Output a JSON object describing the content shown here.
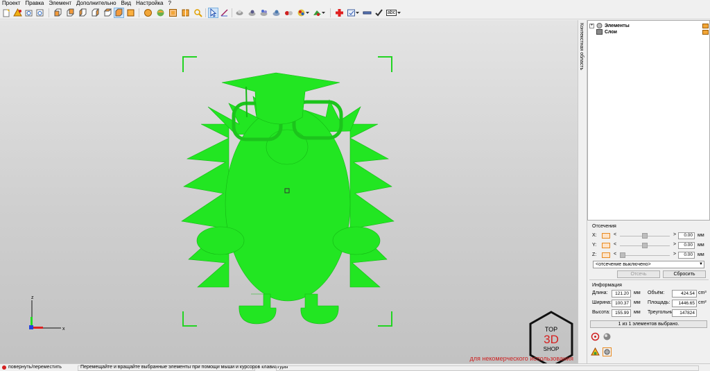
{
  "menu": [
    "Проект",
    "Правка",
    "Элемент",
    "Дополнительно",
    "Вид",
    "Настройка",
    "?"
  ],
  "toolbar_icons": [
    "new-project-icon",
    "add-element-icon",
    "open-icon",
    "save-icon",
    "view-front-icon",
    "view-back-icon",
    "view-left-icon",
    "view-right-icon",
    "view-top-icon",
    "view-perspective-icon",
    "move-icon",
    "rotate-icon",
    "scale-icon",
    "mirror-icon",
    "zoom-icon",
    "select-arrow-icon",
    "measure-icon",
    "sphere-icon",
    "shading-icon",
    "wire-icon",
    "light-icon",
    "color-balls-icon",
    "render-icon",
    "palette-icon",
    "red-cross-icon",
    "settings-icon",
    "minus-icon",
    "checkmark-icon",
    "text-abc-icon"
  ],
  "toolbar_text_abc": "abc",
  "side_tab": "Контекстная область",
  "tree": {
    "items": [
      {
        "label": "Элементы"
      },
      {
        "label": "Слои"
      }
    ]
  },
  "clipping": {
    "title": "Отсечения",
    "axes": [
      {
        "label": "X:",
        "value": "0.00",
        "unit": "мм"
      },
      {
        "label": "Y:",
        "value": "0.00",
        "unit": "мм"
      },
      {
        "label": "Z:",
        "value": "0.00",
        "unit": "мм"
      }
    ],
    "mode": "<отсечение выключено>",
    "apply_label": "Отсечь",
    "reset_label": "Сбросить"
  },
  "info": {
    "title": "Информация",
    "length_label": "Длина:",
    "length": "121.20",
    "length_unit": "мм",
    "width_label": "Ширина:",
    "width": "100.37",
    "width_unit": "мм",
    "height_label": "Высота:",
    "height": "155.99",
    "height_unit": "мм",
    "volume_label": "Объём:",
    "volume": "424.54",
    "volume_unit": "cm³",
    "area_label": "Площадь:",
    "area": "1446.65",
    "area_unit": "cm²",
    "triangles_label": "Треугольники",
    "triangles": "147824"
  },
  "selection": "1 из 1 элементов выбрано.",
  "viewport": {
    "watermark": "для некомерческого использования",
    "axis_x": "x",
    "axis_z": "z",
    "logo": {
      "line1": "TOP",
      "line2": "3D",
      "line3": "SHOP"
    },
    "model_color": "#22e622"
  },
  "status": {
    "mode": "повернуть/переместить",
    "hint": "Перемещайте и вращайте выбранные элементы при помощи мыши и курсоров клавиатуры"
  }
}
